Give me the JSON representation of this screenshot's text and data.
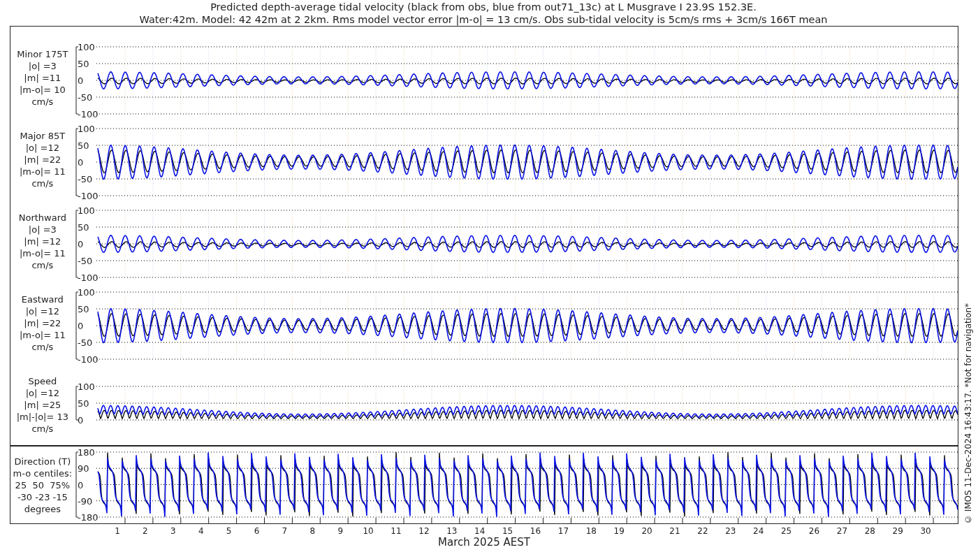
{
  "title": {
    "line_1": "Predicted depth-average tidal velocity (black from obs, blue from out71_13c) at L Musgrave I 23.9S 152.3E.",
    "line_2": "Water:42m. Model: 42 42m at 2 2km. Rms model vector error |m-o| = 13 cm/s. Obs sub-tidal velocity is 5cm/s rms + 3cm/s 166T mean"
  },
  "panels": [
    {
      "kind": "minor",
      "label_lines": [
        "Minor 175T",
        "|o| =3",
        "|m| =11",
        "|m-o|= 10",
        "cm/s"
      ],
      "y_ticks": [
        "100",
        "50",
        "0",
        "-50",
        "-100"
      ]
    },
    {
      "kind": "major",
      "label_lines": [
        "Major 85T",
        "|o| =12",
        "|m| =22",
        "|m-o|= 11",
        "cm/s"
      ],
      "y_ticks": [
        "100",
        "50",
        "0",
        "-50",
        "-100"
      ]
    },
    {
      "kind": "minor",
      "label_lines": [
        "Northward",
        "|o| =3",
        "|m| =12",
        "|m-o|= 11",
        "cm/s"
      ],
      "y_ticks": [
        "100",
        "50",
        "0",
        "-50",
        "-100"
      ]
    },
    {
      "kind": "major",
      "label_lines": [
        "Eastward",
        "|o| =12",
        "|m| =22",
        "|m-o|= 11",
        "cm/s"
      ],
      "y_ticks": [
        "100",
        "50",
        "0",
        "-50",
        "-100"
      ]
    },
    {
      "kind": "speed",
      "label_lines": [
        "Speed",
        "|o| =12",
        "|m| =25",
        "|m|-|o|= 13",
        "cm/s"
      ],
      "y_ticks": [
        "100",
        "50",
        "0"
      ]
    },
    {
      "kind": "direction",
      "label_lines": [
        "Direction (T)",
        "m-o centiles:",
        "25  50  75%",
        "-30 -23 -15",
        "degrees"
      ],
      "y_ticks": [
        "180",
        "90",
        "0",
        "-90",
        "-180"
      ]
    }
  ],
  "x_axis": {
    "day_labels": [
      "1",
      "2",
      "3",
      "4",
      "5",
      "6",
      "7",
      "8",
      "9",
      "10",
      "11",
      "12",
      "13",
      "14",
      "15",
      "16",
      "17",
      "18",
      "19",
      "20",
      "21",
      "22",
      "23",
      "24",
      "25",
      "26",
      "27",
      "28",
      "29",
      "30"
    ],
    "title": "March 2025 AEST"
  },
  "side_note": "© IMOS 11-Dec-2024 16:43:17. *Not for navigation*"
}
